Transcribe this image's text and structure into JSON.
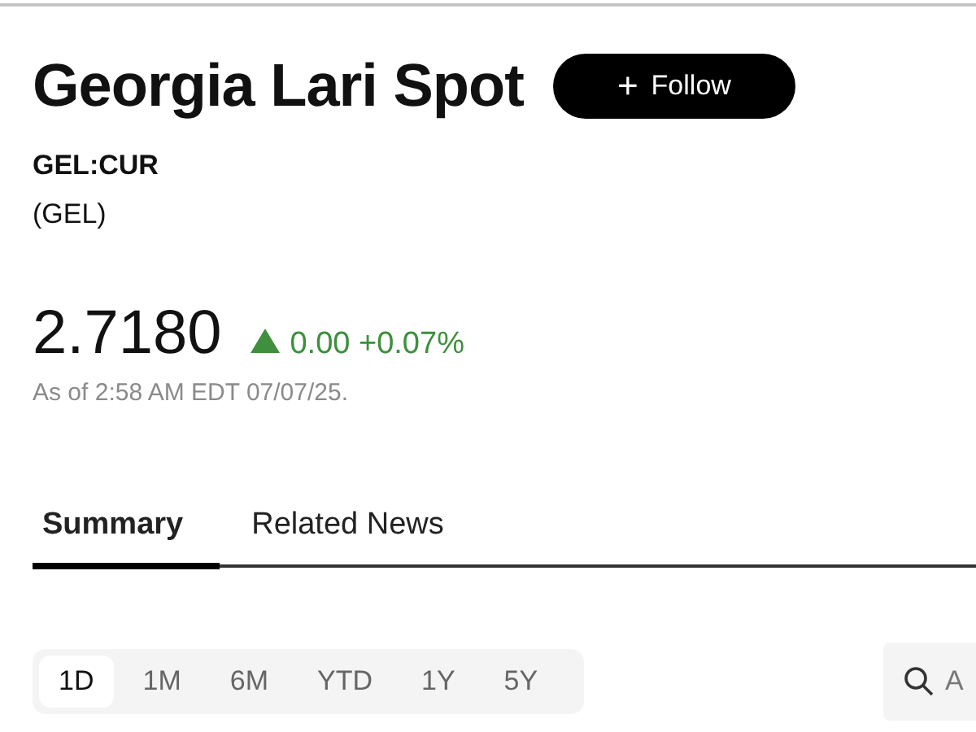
{
  "title": "Georgia Lari Spot",
  "follow_button": {
    "icon": "+",
    "label": "Follow"
  },
  "ticker": "GEL:CUR",
  "currency": "(GEL)",
  "price": "2.7180",
  "change": {
    "rising": true,
    "value": "0.00",
    "percent": "+0.07%"
  },
  "timestamp": "As of 2:58 AM EDT 07/07/25.",
  "tabs": [
    {
      "label": "Summary",
      "selected": true
    },
    {
      "label": "Related News",
      "selected": false
    }
  ],
  "ranges": [
    {
      "label": "1D",
      "selected": true
    },
    {
      "label": "1M",
      "selected": false
    },
    {
      "label": "6M",
      "selected": false
    },
    {
      "label": "YTD",
      "selected": false
    },
    {
      "label": "1Y",
      "selected": false
    },
    {
      "label": "5Y",
      "selected": false
    }
  ],
  "search": {
    "placeholder": "A"
  }
}
